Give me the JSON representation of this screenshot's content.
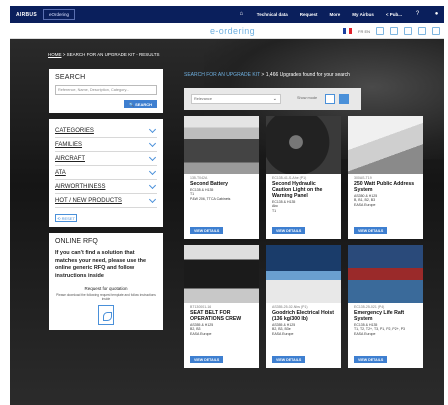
{
  "topnav": {
    "brand": "AIRBUS",
    "portal_tab": "eOrdering",
    "links": [
      "Technical data",
      "Request",
      "More",
      "My Airbus",
      "< Pub... "
    ],
    "icons": [
      "home-icon",
      "help-icon",
      "user-icon"
    ]
  },
  "subbar": {
    "title": "e-ordering",
    "lang": "FR  EN",
    "icons": [
      "flag-icon",
      "document-icon",
      "chat-icon",
      "mail-icon",
      "cart-icon",
      "menu-icon"
    ]
  },
  "breadcrumb": {
    "home": "HOME",
    "trail": " > SEARCH FOR AN UPGRADE KIT - RESULTS"
  },
  "search_panel": {
    "title": "SEARCH",
    "placeholder": "Reference, Name, Description, Category...",
    "button": "SEARCH"
  },
  "filters": [
    "CATEGORIES",
    "FAMILIES",
    "AIRCRAFT",
    "ATA",
    "AIRWORTHINESS",
    "HOT / NEW PRODUCTS"
  ],
  "reset_label": "RESET",
  "rfq": {
    "title": "ONLINE RFQ",
    "text": "If you can't find a solution that matches your need, please use the online generic RFQ and follow instructions inside",
    "sub": "Request for quotation",
    "small": "Please download the following request template and follow instructions inside"
  },
  "results": {
    "prefix": "SEARCH FOR AN UPGRADE KIT",
    "count_text": " > 1,466 Upgrades found for your search",
    "sort_value": "Relevance",
    "show_label": "Show mode"
  },
  "cards": [
    {
      "pn": "135-T042A",
      "title": "Second Battery",
      "meta": [
        "EC135 & H135",
        "T1",
        "P&W 206, TTCA Cabinets"
      ],
      "button": "VIEW DETAILS",
      "img": "img1"
    },
    {
      "pn": "EC135-41-S-Ahe (P1)",
      "title": "Second Hydraulic Caution Light on the Warning Panel",
      "meta": [
        "EC135 & H135",
        "Abc",
        "T1"
      ],
      "button": "VIEW DETAILS",
      "img": "img2"
    },
    {
      "pn": "300AS-T19",
      "title": "250 Watt Public Address System",
      "meta": [
        "AS350 & H125",
        "B, B1, B2, B3",
        "EASA Europe"
      ],
      "button": "VIEW DETAILS",
      "img": "img3"
    },
    {
      "pn": "BT130001-16",
      "title": "SEAT BELT FOR OPERATIONS CREW",
      "meta": [
        "AS355 & H125",
        "B2, B3",
        "EASA Europe"
      ],
      "button": "VIEW DETAILS",
      "img": "img4"
    },
    {
      "pn": "AS355-25-02-Nbs (P1)",
      "title": "Goodrich Electrical Hoist (136 kg/300 lb)",
      "meta": [
        "AS355 & H125",
        "B2, B3, B3e",
        "EASA Europe"
      ],
      "button": "VIEW DETAILS",
      "img": "img5"
    },
    {
      "pn": "EC135-25-021 (P4)",
      "title": "Emergency Life Raft System",
      "meta": [
        "EC135 & H135",
        "T1, T2, T2+, T3, P1, P2, P2+, P3",
        "EASA Europe"
      ],
      "button": "VIEW DETAILS",
      "img": "img6"
    }
  ]
}
